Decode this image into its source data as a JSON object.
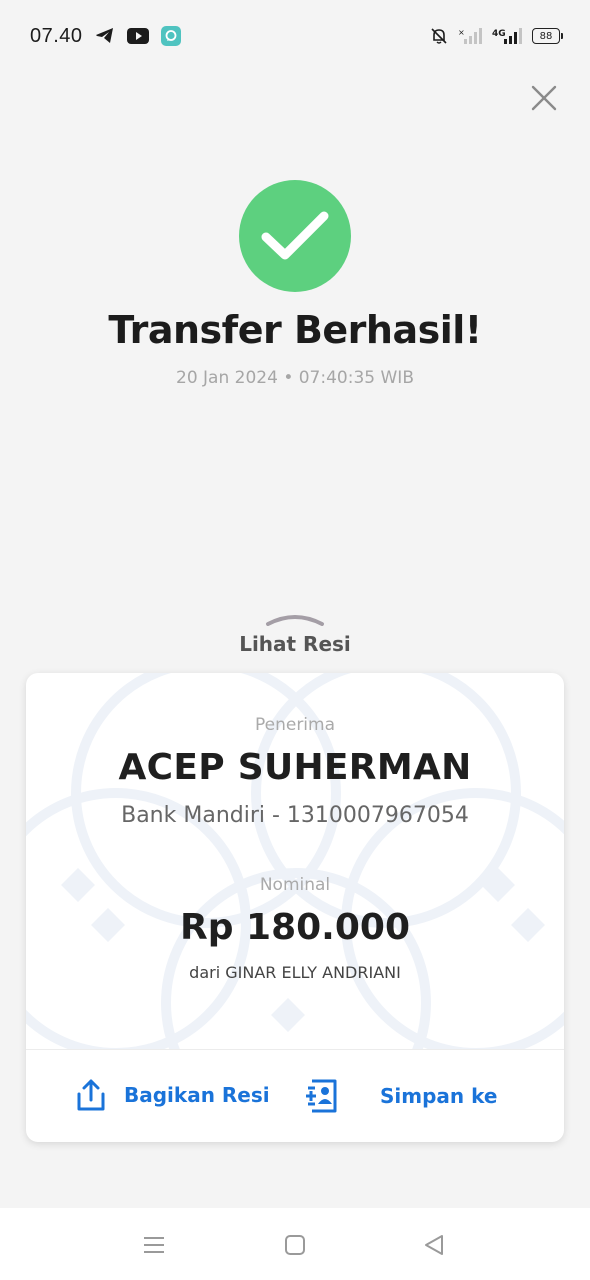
{
  "status_bar": {
    "time": "07.40",
    "battery": "88",
    "network": "4G",
    "icons": [
      "telegram-icon",
      "youtube-icon",
      "chat-app-icon",
      "mute-bell-icon",
      "signal-icon",
      "signal-4g-icon",
      "battery-icon"
    ]
  },
  "header": {
    "close_icon": "close-icon",
    "title": "Transfer Berhasil!",
    "datetime": "20 Jan 2024 • 07:40:35 WIB"
  },
  "receipt_toggle": {
    "label": "Lihat Resi"
  },
  "receipt": {
    "recipient_label": "Penerima",
    "recipient_name": "ACEP SUHERMAN",
    "bank_account": "Bank Mandiri - 1310007967054",
    "amount_label": "Nominal",
    "amount": "Rp 180.000",
    "sender": "dari GINAR ELLY ANDRIANI"
  },
  "actions": {
    "share_label": "Bagikan Resi",
    "save_label": "Simpan ke"
  },
  "colors": {
    "success": "#5dd07f",
    "accent": "#1a73d9",
    "background": "#f4f4f4"
  },
  "nav_bar": {
    "icons": [
      "menu-icon",
      "home-square-icon",
      "back-triangle-icon"
    ]
  }
}
